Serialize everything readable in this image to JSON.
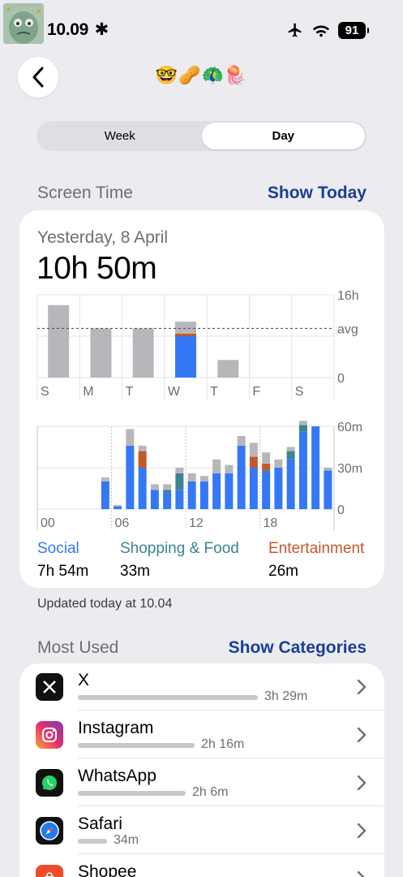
{
  "status": {
    "time": "10.09",
    "battery": "91"
  },
  "header": {
    "emojis": "🤓🥜🦚🪼"
  },
  "segments": {
    "week": "Week",
    "day": "Day"
  },
  "screen_time_section": {
    "title": "Screen Time",
    "link": "Show Today"
  },
  "summary": {
    "date": "Yesterday, 8 April",
    "total": "10h 50m"
  },
  "chart_data": [
    {
      "type": "bar",
      "categories": [
        "S",
        "M",
        "T",
        "W",
        "T",
        "F",
        "S"
      ],
      "series": [
        {
          "values": [
            0,
            0,
            0,
            8.0,
            0,
            0,
            0
          ]
        },
        {
          "values": [
            0,
            0,
            0,
            0.5,
            0,
            0,
            0
          ]
        },
        {
          "values": [
            14.0,
            9.5,
            9.5,
            2.3,
            3.4,
            0,
            0
          ]
        }
      ],
      "colors": [
        "#3478f6",
        "#c2592b",
        "#b7b7bb"
      ],
      "ytick_labels": [
        "16h",
        "avg",
        "0"
      ],
      "avg": 9.5,
      "ylim": [
        0,
        16
      ],
      "grid": true
    },
    {
      "type": "bar",
      "x_tick_labels": [
        "00",
        "06",
        "12",
        "18"
      ],
      "y_tick_labels": [
        "60m",
        "30m",
        "0"
      ],
      "ylim": [
        0,
        60
      ],
      "hours": [
        0,
        1,
        2,
        3,
        4,
        5,
        6,
        7,
        8,
        9,
        10,
        11,
        12,
        13,
        14,
        15,
        16,
        17,
        18,
        19,
        20,
        21,
        22,
        23
      ],
      "series": [
        {
          "name": "Social",
          "values": [
            0,
            0,
            0,
            0,
            0,
            20,
            2,
            46,
            30,
            14,
            12,
            14,
            20,
            20,
            26,
            26,
            46,
            30,
            28,
            30,
            36,
            56,
            60,
            28
          ]
        },
        {
          "name": "Shopping & Food",
          "values": [
            0,
            0,
            0,
            0,
            0,
            0,
            0,
            0,
            0,
            0,
            2,
            12,
            0,
            0,
            0,
            0,
            0,
            0,
            0,
            0,
            6,
            5,
            0,
            0
          ]
        },
        {
          "name": "Entertainment",
          "values": [
            0,
            0,
            0,
            0,
            0,
            0,
            0,
            0,
            12,
            0,
            0,
            0,
            0,
            0,
            0,
            0,
            0,
            8,
            5,
            0,
            0,
            0,
            0,
            0
          ]
        },
        {
          "name": "Other",
          "values": [
            0,
            0,
            0,
            0,
            0,
            3,
            1,
            12,
            4,
            4,
            4,
            4,
            6,
            4,
            10,
            6,
            7,
            10,
            8,
            6,
            3,
            3,
            0,
            2
          ]
        }
      ],
      "colors": [
        "#3478f6",
        "#3a8494",
        "#c2592b",
        "#b7b7bb"
      ]
    }
  ],
  "legend": [
    {
      "name": "Social",
      "value": "7h 54m",
      "color": "#3478f6"
    },
    {
      "name": "Shopping & Food",
      "value": "33m",
      "color": "#3a8494"
    },
    {
      "name": "Entertainment",
      "value": "26m",
      "color": "#c2592b"
    }
  ],
  "updated": "Updated today at 10.04",
  "most_used_section": {
    "title": "Most Used",
    "link": "Show Categories"
  },
  "apps": [
    {
      "name": "X",
      "time": "3h 29m",
      "usage_fraction": 1.0,
      "icon": "x-icon",
      "color": "#000000"
    },
    {
      "name": "Instagram",
      "time": "2h 16m",
      "usage_fraction": 0.65,
      "icon": "instagram-icon",
      "color": "#d62976"
    },
    {
      "name": "WhatsApp",
      "time": "2h 6m",
      "usage_fraction": 0.6,
      "icon": "whatsapp-icon",
      "color": "#25d366"
    },
    {
      "name": "Safari",
      "time": "34m",
      "usage_fraction": 0.16,
      "icon": "safari-icon",
      "color": "#1e7cf2"
    },
    {
      "name": "Shopee",
      "icon": "shopee-icon",
      "color": "#ee4d2d"
    }
  ]
}
